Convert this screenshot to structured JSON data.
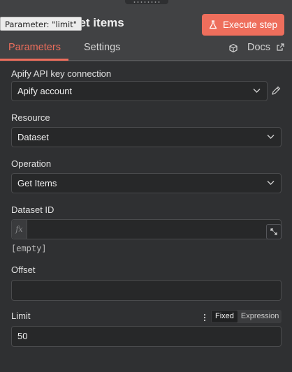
{
  "tooltip": "Parameter: \"limit\"",
  "header": {
    "title": "Get dataset items",
    "execute_label": "Execute step",
    "accent": "#ee6e5c"
  },
  "tabs": {
    "parameters": "Parameters",
    "settings": "Settings",
    "docs": "Docs"
  },
  "params": {
    "credential": {
      "label": "Apify API key connection",
      "value": "Apify account"
    },
    "resource": {
      "label": "Resource",
      "value": "Dataset"
    },
    "operation": {
      "label": "Operation",
      "value": "Get Items"
    },
    "dataset_id": {
      "label": "Dataset ID",
      "fx": "fx",
      "value": "",
      "hint": "[empty]"
    },
    "offset": {
      "label": "Offset",
      "value": ""
    },
    "limit": {
      "label": "Limit",
      "value": "50",
      "mode_fixed": "Fixed",
      "mode_expression": "Expression"
    }
  },
  "icons": {
    "execute": "flask-icon",
    "docs": "cube-icon",
    "external": "external-link-icon",
    "edit": "pencil-icon",
    "expand": "expand-icon",
    "more": "kebab-icon",
    "dropdown": "chevron-down-icon"
  }
}
